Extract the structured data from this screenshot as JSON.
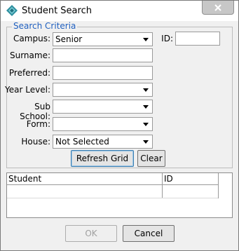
{
  "window": {
    "title": "Student Search"
  },
  "search_criteria": {
    "legend": "Search Criteria",
    "campus": {
      "label": "Campus:",
      "value": "Senior"
    },
    "id": {
      "label": "ID:",
      "value": ""
    },
    "surname": {
      "label": "Surname:",
      "value": ""
    },
    "preferred": {
      "label": "Preferred:",
      "value": ""
    },
    "year_level": {
      "label": "Year Level:",
      "value": ""
    },
    "sub_school": {
      "label": "Sub School:",
      "value": ""
    },
    "form": {
      "label": "Form:",
      "value": ""
    },
    "house": {
      "label": "House:",
      "value": "Not Selected"
    },
    "refresh_label": "Refresh Grid",
    "clear_label": "Clear"
  },
  "grid": {
    "columns": [
      "Student",
      "ID"
    ]
  },
  "footer": {
    "ok_label": "OK",
    "cancel_label": "Cancel"
  },
  "colors": {
    "legend": "#1f5fbf",
    "window_bg": "#f0f0f0"
  },
  "icons": {
    "app": "diamond-app-icon",
    "close": "close-icon",
    "dropdown": "chevron-down-icon"
  }
}
